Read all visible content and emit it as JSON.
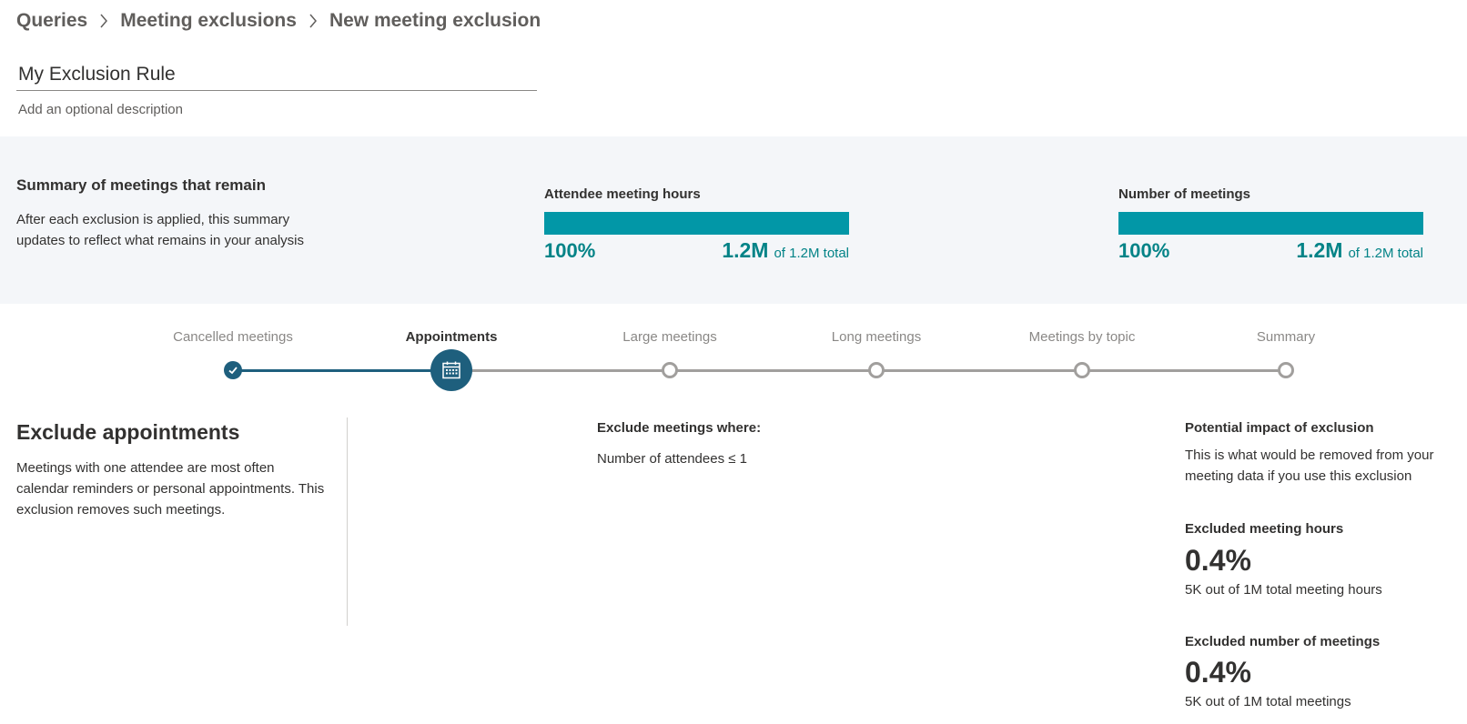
{
  "breadcrumb": {
    "items": [
      "Queries",
      "Meeting exclusions",
      "New meeting exclusion"
    ]
  },
  "form": {
    "name_value": "My Exclusion Rule",
    "description_placeholder": "Add an optional description"
  },
  "summary": {
    "title": "Summary of meetings that remain",
    "description": "After each exclusion is applied, this summary updates to reflect what remains in your analysis",
    "metrics": [
      {
        "label": "Attendee meeting hours",
        "percent": "100%",
        "fill_fraction": 1.0,
        "value": "1.2M",
        "total": "of 1.2M total"
      },
      {
        "label": "Number of meetings",
        "percent": "100%",
        "fill_fraction": 1.0,
        "value": "1.2M",
        "total": "of 1.2M total"
      }
    ]
  },
  "stepper": {
    "steps": [
      {
        "label": "Cancelled meetings",
        "state": "done"
      },
      {
        "label": "Appointments",
        "state": "active",
        "icon": "calendar-icon"
      },
      {
        "label": "Large meetings",
        "state": "todo"
      },
      {
        "label": "Long meetings",
        "state": "todo"
      },
      {
        "label": "Meetings by topic",
        "state": "todo"
      },
      {
        "label": "Summary",
        "state": "todo"
      }
    ]
  },
  "exclusion": {
    "title": "Exclude appointments",
    "description": "Meetings with one attendee are most often calendar reminders or personal appointments. This exclusion removes such meetings.",
    "where_title": "Exclude meetings where:",
    "condition": "Number of attendees ≤ 1"
  },
  "impact": {
    "title": "Potential impact of exclusion",
    "description": "This is what would be removed from your meeting data if you use this exclusion",
    "hours_label": "Excluded meeting hours",
    "hours_value": "0.4%",
    "hours_sub": "5K out of 1M total meeting hours",
    "meetings_label": "Excluded number of meetings",
    "meetings_value": "0.4%",
    "meetings_sub": "5K out of 1M total meetings"
  },
  "colors": {
    "teal": "#0297a7",
    "teal_text": "#038387",
    "step_active": "#1e5f7d",
    "step_todo": "#a19f9d",
    "band_bg": "#f4f6f9"
  }
}
